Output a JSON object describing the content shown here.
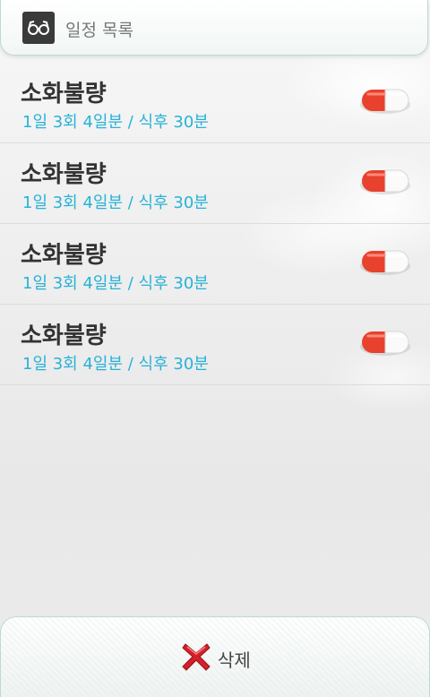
{
  "header": {
    "title": "일정 목록",
    "icon": "glasses-icon"
  },
  "schedules": [
    {
      "name": "소화불량",
      "detail": "1일 3회 4일분 / 식후 30분",
      "icon": "capsule-icon"
    },
    {
      "name": "소화불량",
      "detail": "1일 3회 4일분 / 식후 30분",
      "icon": "capsule-icon"
    },
    {
      "name": "소화불량",
      "detail": "1일 3회 4일분 / 식후 30분",
      "icon": "capsule-icon"
    },
    {
      "name": "소화불량",
      "detail": "1일 3회 4일분 / 식후 30분",
      "icon": "capsule-icon"
    }
  ],
  "footer": {
    "delete_label": "삭제",
    "delete_icon": "red-x-icon"
  },
  "colors": {
    "accent_text": "#27b2d7",
    "capsule_red": "#e8412e",
    "delete_red": "#d3202a",
    "frame_border": "#b9dad6"
  }
}
